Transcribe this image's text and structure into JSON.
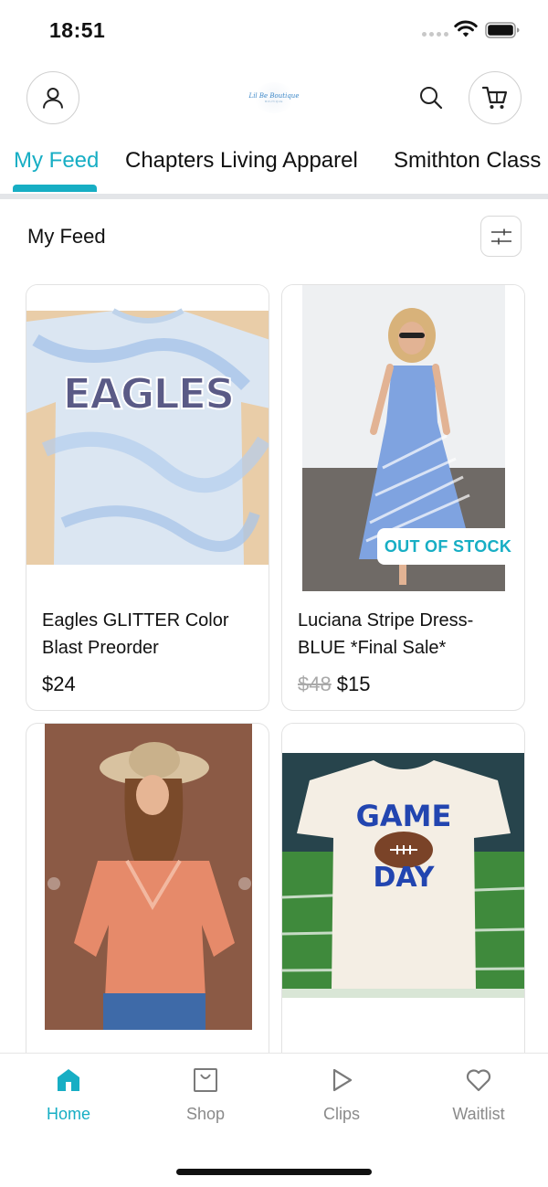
{
  "status_bar": {
    "time": "18:51"
  },
  "header": {
    "logo_text": "Lil Be Boutique",
    "logo_subtext": "BOUTIQUE",
    "account_icon": "user-icon",
    "search_icon": "search-icon",
    "cart_icon": "cart-icon"
  },
  "tabs": [
    {
      "label": "My Feed",
      "active": true
    },
    {
      "label": "Chapters Living Apparel",
      "active": false
    },
    {
      "label": "Smithton Class",
      "active": false
    }
  ],
  "feed": {
    "title": "My Feed",
    "filter_icon": "sliders-icon"
  },
  "products": [
    {
      "name": "Eagles GLITTER Color Blast Preorder",
      "price": "$24",
      "badge": ""
    },
    {
      "name": "Luciana Stripe Dress-BLUE *Final Sale*",
      "original_price": "$48",
      "price": "$15",
      "badge": "OUT OF STOCK"
    },
    {
      "name": "",
      "price": "",
      "badge": ""
    },
    {
      "name": "",
      "price": "",
      "badge": ""
    }
  ],
  "bottom_nav": [
    {
      "label": "Home",
      "icon": "home-icon",
      "active": true
    },
    {
      "label": "Shop",
      "icon": "shopping-bag-icon",
      "active": false
    },
    {
      "label": "Clips",
      "icon": "play-icon",
      "active": false
    },
    {
      "label": "Waitlist",
      "icon": "heart-icon",
      "active": false
    }
  ],
  "colors": {
    "accent": "#17aec4",
    "text": "#111111",
    "muted": "#8a8a8a",
    "strikethrough": "#a9a9a9"
  }
}
